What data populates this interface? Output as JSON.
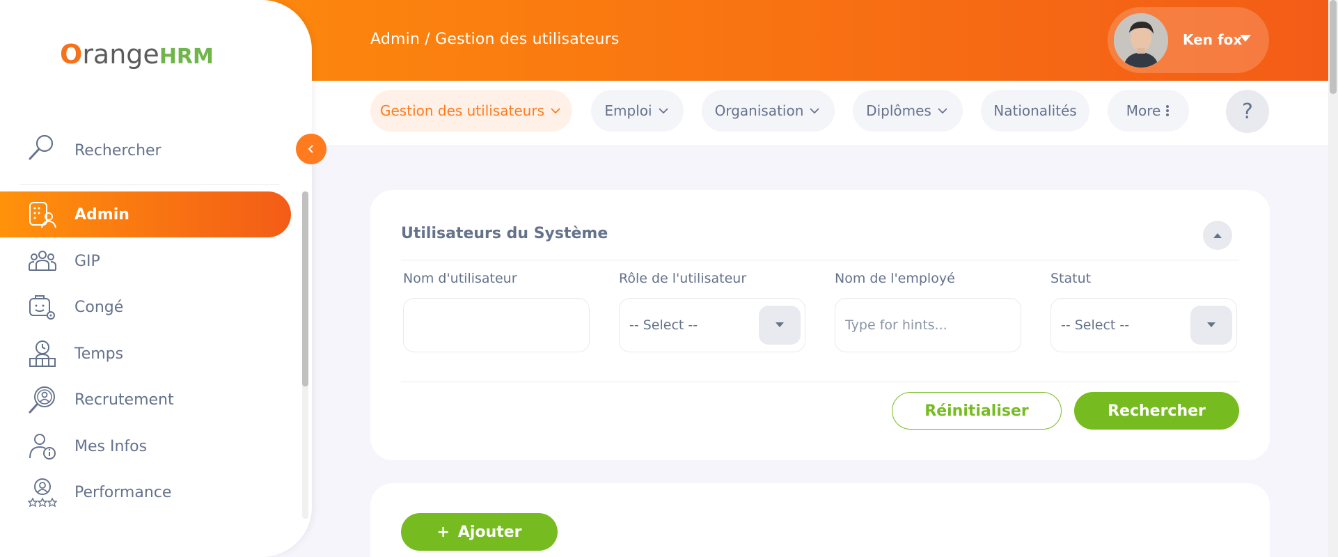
{
  "header": {
    "breadcrumb": "Admin / Gestion des utilisateurs",
    "user_name": "Ken fox"
  },
  "topnav": {
    "tabs": [
      {
        "label": "Gestion des utilisateurs",
        "active": true,
        "has_dropdown": true
      },
      {
        "label": "Emploi",
        "active": false,
        "has_dropdown": true
      },
      {
        "label": "Organisation",
        "active": false,
        "has_dropdown": true
      },
      {
        "label": "Diplômes",
        "active": false,
        "has_dropdown": true
      },
      {
        "label": "Nationalités",
        "active": false,
        "has_dropdown": false
      },
      {
        "label": "More",
        "active": false,
        "has_dropdown": false
      }
    ],
    "help_label": "?"
  },
  "sidebar": {
    "logo_text": "range",
    "logo_o": "O",
    "logo_hrm": "HRM",
    "search_label": "Rechercher",
    "items": [
      {
        "label": "Admin",
        "icon": "admin-icon",
        "active": true
      },
      {
        "label": "GIP",
        "icon": "people-icon",
        "active": false
      },
      {
        "label": "Congé",
        "icon": "leave-icon",
        "active": false
      },
      {
        "label": "Temps",
        "icon": "time-icon",
        "active": false
      },
      {
        "label": "Recrutement",
        "icon": "recruitment-icon",
        "active": false
      },
      {
        "label": "Mes Infos",
        "icon": "my-info-icon",
        "active": false
      },
      {
        "label": "Performance",
        "icon": "performance-icon",
        "active": false
      }
    ]
  },
  "filter": {
    "title": "Utilisateurs du Système",
    "fields": {
      "username_label": "Nom d'utilisateur",
      "username_value": "",
      "role_label": "Rôle de l'utilisateur",
      "role_value": "-- Select --",
      "employee_label": "Nom de l'employé",
      "employee_placeholder": "Type for hints...",
      "status_label": "Statut",
      "status_value": "-- Select --"
    },
    "reset_label": "Réinitialiser",
    "search_label": "Rechercher"
  },
  "records": {
    "add_label": "Ajouter",
    "add_symbol": "+"
  },
  "colors": {
    "brand_orange": "#ff7b1d",
    "brand_green": "#76bc21",
    "text": "#64728c"
  }
}
